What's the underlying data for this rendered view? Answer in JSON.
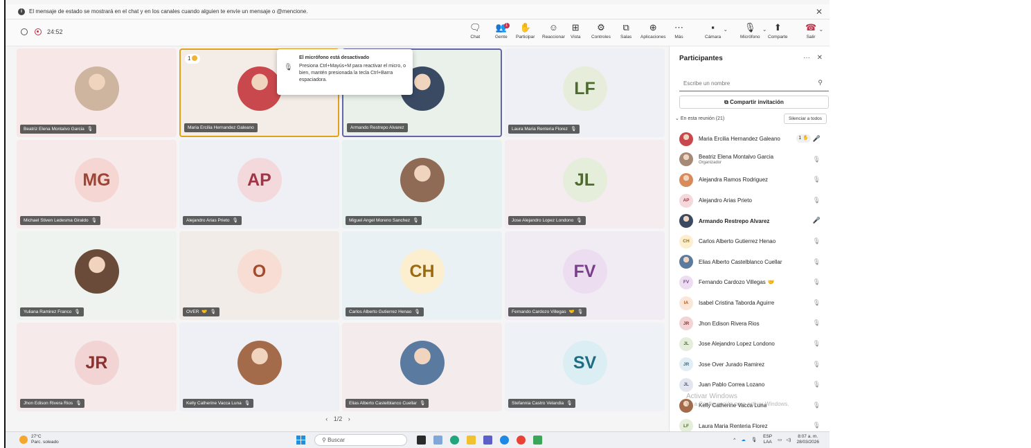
{
  "banner": {
    "message": "El mensaje de estado se mostrará en el chat y en los canales cuando alguien te envíe un mensaje o @mencione."
  },
  "meeting": {
    "timer": "24:52"
  },
  "toolbar": {
    "chat": "Chat",
    "people": "Gente",
    "people_badge": "1",
    "raise": "Participar",
    "react": "Reaccionar",
    "view": "Vista",
    "controls": "Controles",
    "rooms": "Salas",
    "apps": "Aplicaciones",
    "more": "Más",
    "camera": "Cámara",
    "mic": "Micrófono",
    "share": "Comparte",
    "leave": "Salir"
  },
  "tooltip": {
    "title": "El micrófono está desactivado",
    "body": "Presiona Ctrl+Mayús+M para reactivar el micro, o bien, mantén presionada la tecla Ctrl+Barra espaciadora."
  },
  "tiles": [
    {
      "name": "Beatriz Elena Montalvo Garcia",
      "initials": "",
      "bg": "#f7e7e7",
      "avatar": "#cdb59f"
    },
    {
      "name": "Maria Ercilia Hernandez Galeano",
      "initials": "",
      "bg": "#f4ede7",
      "avatar": "#c9484d",
      "hand": "1"
    },
    {
      "name": "Armando Restrepo Alvarez",
      "initials": "",
      "bg": "#e9f1ea",
      "avatar": "#3b4a63"
    },
    {
      "name": "Laura Maria Renteria Florez",
      "initials": "LF",
      "bg": "#eef0f6",
      "avatar": "#e6eedb",
      "fg": "#4d6b2d"
    },
    {
      "name": "Michael Stiven Ledesma Giraldo",
      "initials": "MG",
      "bg": "#f6eaea",
      "avatar": "#f6d6d2",
      "fg": "#9c4435"
    },
    {
      "name": "Alejandro Arias Prieto",
      "initials": "AP",
      "bg": "#eef0f5",
      "avatar": "#f3d9dc",
      "fg": "#a33446"
    },
    {
      "name": "Miguel Angel Moreno Sanchez",
      "initials": "",
      "bg": "#e7f1f0",
      "avatar": "#8f6a55"
    },
    {
      "name": "Jose Alejandro Lopez Londono",
      "initials": "JL",
      "bg": "#f4ecef",
      "avatar": "#e4eeda",
      "fg": "#4d6b2d"
    },
    {
      "name": "Yuliana Ramirez Franco",
      "initials": "",
      "bg": "#eef3f0",
      "avatar": "#6a4b3a"
    },
    {
      "name": "OVER",
      "initials": "O",
      "bg": "#f2ece9",
      "avatar": "#f7ddd4",
      "fg": "#a44a2d",
      "extra": "🤝"
    },
    {
      "name": "Carlos Alberto Gutierrez Henao",
      "initials": "CH",
      "bg": "#eaf1f5",
      "avatar": "#fbefcf",
      "fg": "#9b6a12"
    },
    {
      "name": "Fernando Cardozo Villegas",
      "initials": "FV",
      "bg": "#f1ecf4",
      "avatar": "#ecdef0",
      "fg": "#7a3f8a",
      "extra": "🤝"
    },
    {
      "name": "Jhon Edison Rivera Rios",
      "initials": "JR",
      "bg": "#f6eaea",
      "avatar": "#f2d4d4",
      "fg": "#8d3030"
    },
    {
      "name": "Kelly Catherine Vacca Luna",
      "initials": "",
      "bg": "#eef0f5",
      "avatar": "#a46b4a"
    },
    {
      "name": "Elias Alberto Castelblanco Cuellar",
      "initials": "",
      "bg": "#f4ecec",
      "avatar": "#5a7aa0"
    },
    {
      "name": "Stefannia Castro Velandia",
      "initials": "SV",
      "bg": "#eef2f6",
      "avatar": "#dbeef3",
      "fg": "#1d6e83"
    }
  ],
  "pager": "1/2",
  "panel": {
    "title": "Participantes",
    "search_placeholder": "Escribe un nombre",
    "invite": "Compartir invitación",
    "section": "En esta reunión (21)",
    "mute_all": "Silenciar a todos",
    "participants": [
      {
        "name": "Maria Ercilia Hernandez Galeano",
        "initials": "",
        "color": "#c9484d",
        "hand": "1",
        "mic": "on"
      },
      {
        "name": "Beatriz Elena Montalvo Garcia",
        "role": "Organizador",
        "initials": "",
        "color": "#a58b77",
        "mic": "off"
      },
      {
        "name": "Alejandra Ramos Rodriguez",
        "initials": "",
        "color": "#d88a5a",
        "mic": "off"
      },
      {
        "name": "Alejandro Arias Prieto",
        "initials": "AP",
        "color": "#f3d9dc",
        "fg": "#a33446",
        "mic": "off"
      },
      {
        "name": "Armando Restrepo Alvarez",
        "initials": "",
        "color": "#3b4a63",
        "mic": "on",
        "bold": true
      },
      {
        "name": "Carlos Alberto Gutierrez Henao",
        "initials": "CH",
        "color": "#fbefcf",
        "fg": "#9b6a12",
        "mic": "off"
      },
      {
        "name": "Elias Alberto Castelblanco Cuellar",
        "initials": "",
        "color": "#5a7aa0",
        "mic": "off"
      },
      {
        "name": "Fernando Cardozo Villegas",
        "initials": "FV",
        "color": "#ecdef0",
        "fg": "#7a3f8a",
        "mic": "off",
        "extra": "🤝"
      },
      {
        "name": "Isabel Cristina Taborda Aguirre",
        "initials": "IA",
        "color": "#fbe7d9",
        "fg": "#b45a1b",
        "mic": "off"
      },
      {
        "name": "Jhon Edison Rivera Rios",
        "initials": "JR",
        "color": "#f2d4d4",
        "fg": "#8d3030",
        "mic": "off"
      },
      {
        "name": "Jose Alejandro Lopez Londono",
        "initials": "JL",
        "color": "#e4eeda",
        "fg": "#4d6b2d",
        "mic": "off"
      },
      {
        "name": "Jose Over Jurado Ramirez",
        "initials": "JR",
        "color": "#e1eef6",
        "fg": "#2f6b92",
        "mic": "off"
      },
      {
        "name": "Juan Pablo Correa Lozano",
        "initials": "JL",
        "color": "#e3e6ee",
        "fg": "#4a5577",
        "mic": "off"
      },
      {
        "name": "Kelly Catherine Vacca Luna",
        "initials": "",
        "color": "#a46b4a",
        "mic": "off"
      },
      {
        "name": "Laura Maria Renteria Florez",
        "initials": "LF",
        "color": "#e6eedb",
        "fg": "#4d6b2d",
        "mic": "off"
      }
    ]
  },
  "watermark": {
    "line1": "Activar Windows",
    "line2": "Ve a Configuración para activar Windows."
  },
  "taskbar": {
    "temp": "27°C",
    "weather": "Parc. soleado",
    "search": "Buscar",
    "lang1": "ESP",
    "lang2": "LAA",
    "time": "8:07 a. m.",
    "date": "28/03/2026"
  }
}
